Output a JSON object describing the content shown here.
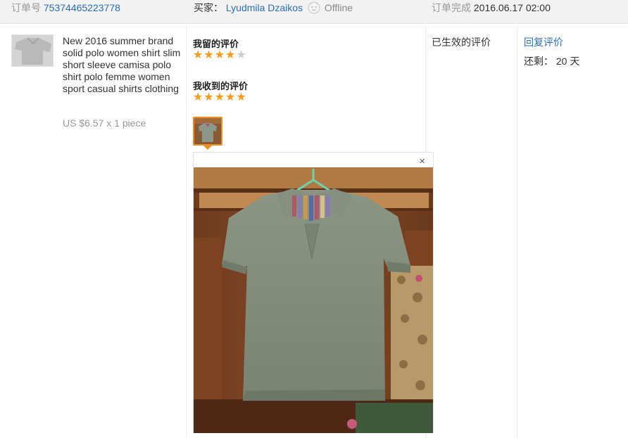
{
  "header": {
    "order_label": "订单号",
    "order_number": "75374465223778",
    "buyer_label": "买家：",
    "buyer_name": "Lyudmila Dzaikos",
    "buyer_status": "Offline",
    "completed_label": "订单完成",
    "completed_time": "2016.06.17 02:00"
  },
  "product": {
    "title": "New 2016 summer brand solid polo women shirt slim short sleeve camisa polo shirt polo femme women sport casual shirts clothing",
    "price": "US $6.57 x 1 piece"
  },
  "feedback": {
    "my_label": "我留的评价",
    "my_rating": 4,
    "received_label": "我收到的评价",
    "received_rating": 5,
    "close_icon": "×"
  },
  "status": {
    "effective": "已生效的评价"
  },
  "actions": {
    "reply": "回复评价",
    "remaining_label": "还剩：",
    "remaining_value": "20 天"
  },
  "colors": {
    "link": "#2a6fb5",
    "star": "#f59a1a",
    "thumb_border": "#f08c1e"
  }
}
